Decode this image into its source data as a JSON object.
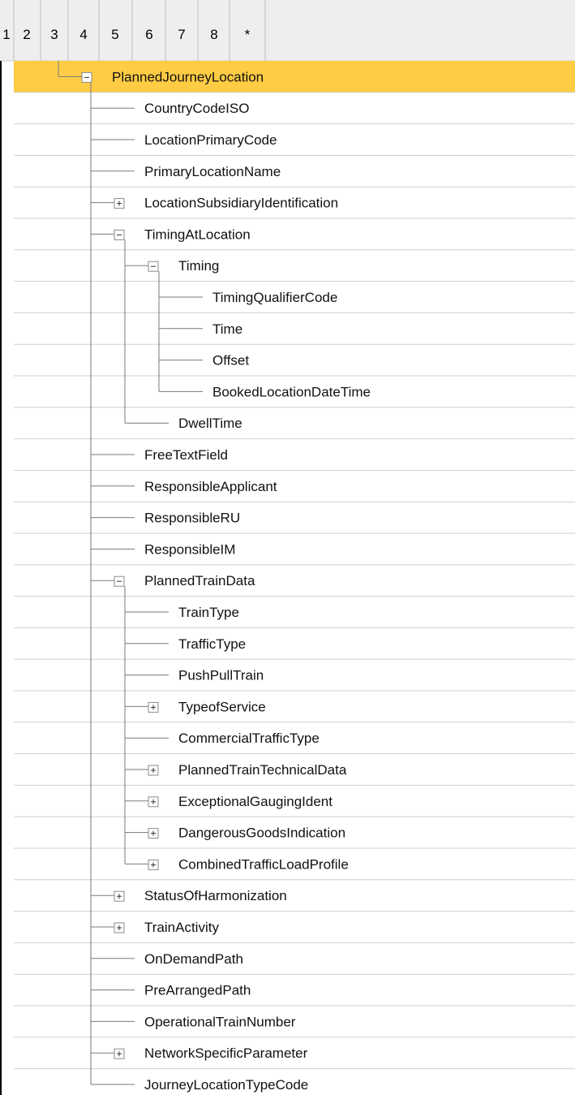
{
  "header": {
    "levels": [
      "1",
      "2",
      "3",
      "4",
      "5",
      "6",
      "7",
      "8",
      "*"
    ]
  },
  "selection_color": "#FFCC44",
  "rows": [
    {
      "label": "PlannedJourneyLocation",
      "depth": 1,
      "expander": "minus",
      "selected": true
    },
    {
      "label": "CountryCodeISO",
      "depth": 2,
      "expander": "none"
    },
    {
      "label": "LocationPrimaryCode",
      "depth": 2,
      "expander": "none"
    },
    {
      "label": "PrimaryLocationName",
      "depth": 2,
      "expander": "none"
    },
    {
      "label": "LocationSubsidiaryIdentification",
      "depth": 2,
      "expander": "plus"
    },
    {
      "label": "TimingAtLocation",
      "depth": 2,
      "expander": "minus"
    },
    {
      "label": "Timing",
      "depth": 3,
      "expander": "minus"
    },
    {
      "label": "TimingQualifierCode",
      "depth": 4,
      "expander": "none"
    },
    {
      "label": "Time",
      "depth": 4,
      "expander": "none"
    },
    {
      "label": "Offset",
      "depth": 4,
      "expander": "none"
    },
    {
      "label": "BookedLocationDateTime",
      "depth": 4,
      "expander": "none"
    },
    {
      "label": "DwellTime",
      "depth": 3,
      "expander": "none"
    },
    {
      "label": "FreeTextField",
      "depth": 2,
      "expander": "none"
    },
    {
      "label": "ResponsibleApplicant",
      "depth": 2,
      "expander": "none"
    },
    {
      "label": "ResponsibleRU",
      "depth": 2,
      "expander": "none"
    },
    {
      "label": "ResponsibleIM",
      "depth": 2,
      "expander": "none"
    },
    {
      "label": "PlannedTrainData",
      "depth": 2,
      "expander": "minus"
    },
    {
      "label": "TrainType",
      "depth": 3,
      "expander": "none"
    },
    {
      "label": "TrafficType",
      "depth": 3,
      "expander": "none"
    },
    {
      "label": "PushPullTrain",
      "depth": 3,
      "expander": "none"
    },
    {
      "label": "TypeofService",
      "depth": 3,
      "expander": "plus"
    },
    {
      "label": "CommercialTrafficType",
      "depth": 3,
      "expander": "none"
    },
    {
      "label": "PlannedTrainTechnicalData",
      "depth": 3,
      "expander": "plus"
    },
    {
      "label": "ExceptionalGaugingIdent",
      "depth": 3,
      "expander": "plus"
    },
    {
      "label": "DangerousGoodsIndication",
      "depth": 3,
      "expander": "plus"
    },
    {
      "label": "CombinedTrafficLoadProfile",
      "depth": 3,
      "expander": "plus"
    },
    {
      "label": "StatusOfHarmonization",
      "depth": 2,
      "expander": "plus"
    },
    {
      "label": "TrainActivity",
      "depth": 2,
      "expander": "plus"
    },
    {
      "label": "OnDemandPath",
      "depth": 2,
      "expander": "none"
    },
    {
      "label": "PreArrangedPath",
      "depth": 2,
      "expander": "none"
    },
    {
      "label": "OperationalTrainNumber",
      "depth": 2,
      "expander": "none"
    },
    {
      "label": "NetworkSpecificParameter",
      "depth": 2,
      "expander": "plus"
    },
    {
      "label": "JourneyLocationTypeCode",
      "depth": 2,
      "expander": "none"
    }
  ]
}
